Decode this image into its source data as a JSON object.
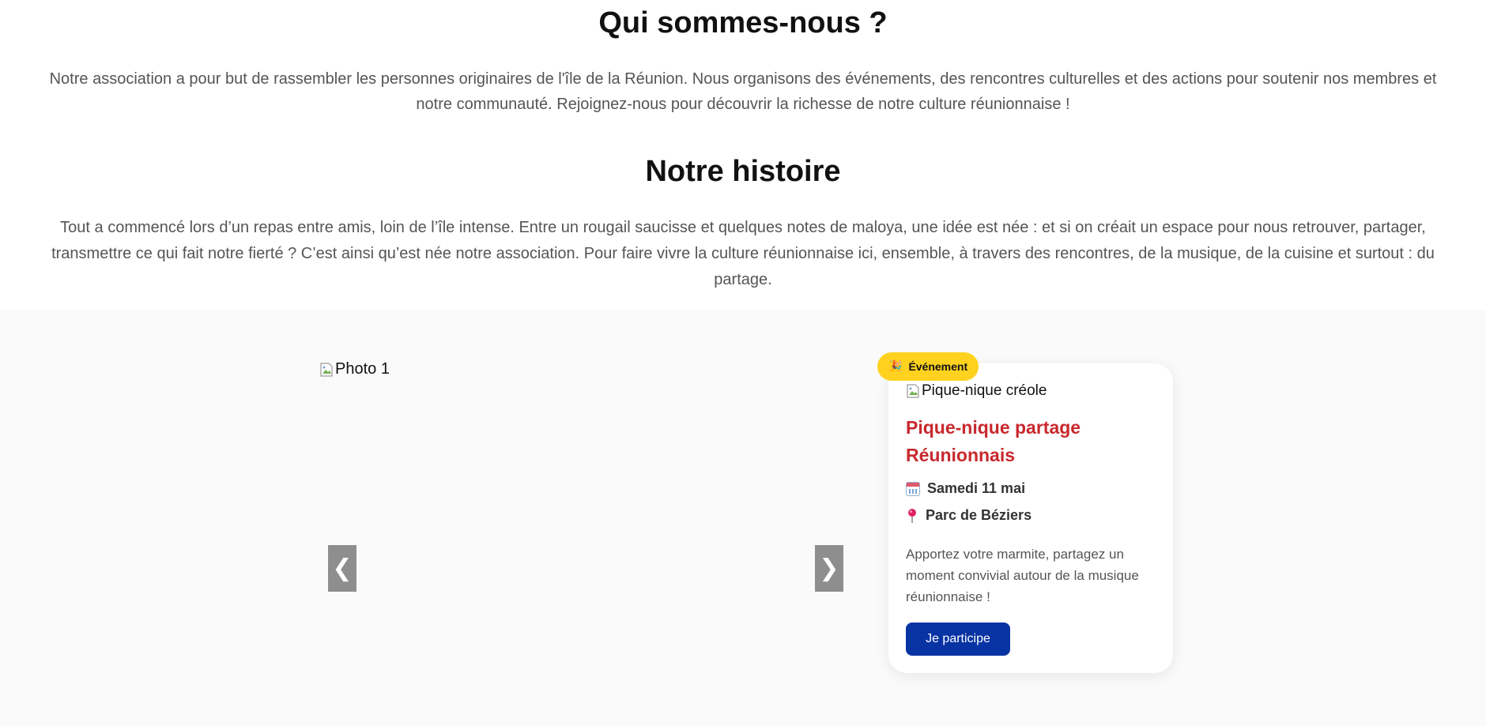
{
  "about": {
    "title": "Qui sommes-nous ?",
    "text": "Notre association a pour but de rassembler les personnes originaires de l'île de la Réunion. Nous organisons des événements, des rencontres culturelles et des actions pour soutenir nos membres et notre communauté. Rejoignez-nous pour découvrir la richesse de notre culture réunionnaise !"
  },
  "history": {
    "title": "Notre histoire",
    "text": "Tout a commencé lors d’un repas entre amis, loin de l’île intense. Entre un rougail saucisse et quelques notes de maloya, une idée est née : et si on créait un espace pour nous retrouver, partager, transmettre ce qui fait notre fierté ? C’est ainsi qu’est née notre association. Pour faire vivre la culture réunionnaise ici, ensemble, à travers des rencontres, de la musique, de la cuisine et surtout : du partage."
  },
  "carousel": {
    "image_alt": "Photo 1",
    "prev_label": "❮",
    "next_label": "❯"
  },
  "event_card": {
    "badge_icon": "🎉",
    "badge_label": "Événement",
    "image_alt": "Pique-nique créole",
    "title": "Pique-nique partage Réunionnais",
    "date": "Samedi 11 mai",
    "place": "Parc de Béziers",
    "description": "Apportez votre marmite, partagez un moment convivial autour de la musique réunionnaise !",
    "cta_label": "Je participe"
  },
  "colors": {
    "badge_bg": "#ffd21f",
    "title_red": "#c8282d",
    "cta_blue": "#0733a3",
    "nav_gray": "#8e8e8e"
  },
  "icons": {
    "badge": "party-popper-icon",
    "date": "calendar-icon",
    "place": "pin-icon",
    "broken_image": "broken-image-icon"
  }
}
